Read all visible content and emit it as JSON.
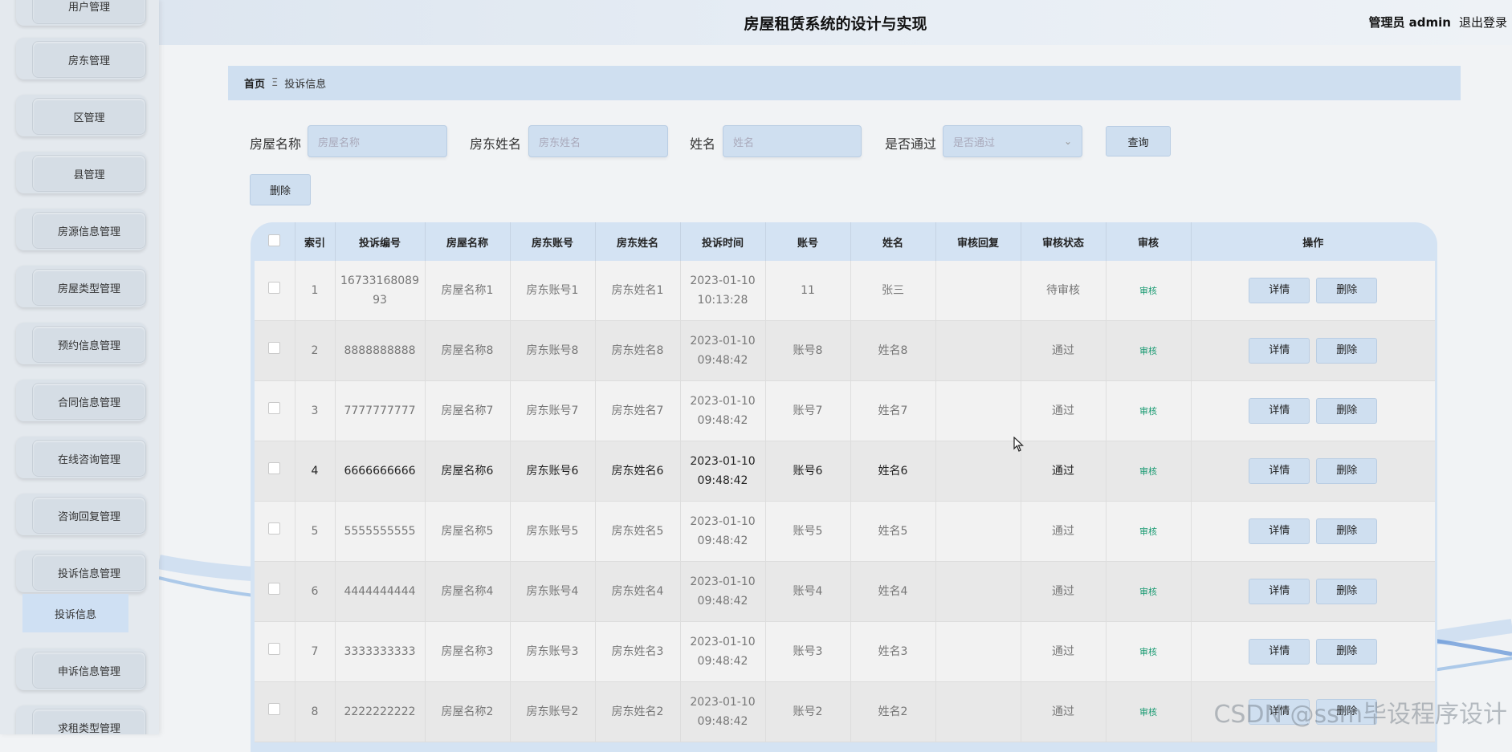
{
  "app_title": "房屋租赁系统的设计与实现",
  "user": {
    "label": "管理员 admin",
    "logout": "退出登录"
  },
  "sidebar": {
    "items": [
      {
        "label": "用户管理"
      },
      {
        "label": "房东管理"
      },
      {
        "label": "区管理"
      },
      {
        "label": "县管理"
      },
      {
        "label": "房源信息管理"
      },
      {
        "label": "房屋类型管理"
      },
      {
        "label": "预约信息管理"
      },
      {
        "label": "合同信息管理"
      },
      {
        "label": "在线咨询管理"
      },
      {
        "label": "咨询回复管理"
      },
      {
        "label": "投诉信息管理"
      },
      {
        "label": "申诉信息管理"
      },
      {
        "label": "求租类型管理"
      }
    ],
    "active_sub": "投诉信息"
  },
  "breadcrumb": {
    "home": "首页",
    "sep": "Ξ",
    "current": "投诉信息"
  },
  "search": {
    "house_name": {
      "label": "房屋名称",
      "placeholder": "房屋名称"
    },
    "landlord_name": {
      "label": "房东姓名",
      "placeholder": "房东姓名"
    },
    "name": {
      "label": "姓名",
      "placeholder": "姓名"
    },
    "passed": {
      "label": "是否通过",
      "placeholder": "是否通过"
    },
    "query_label": "查询"
  },
  "delete_label": "删除",
  "table": {
    "headers": [
      "索引",
      "投诉编号",
      "房屋名称",
      "房东账号",
      "房东姓名",
      "投诉时间",
      "账号",
      "姓名",
      "审核回复",
      "审核状态",
      "审核",
      "操作"
    ],
    "rows": [
      {
        "idx": "1",
        "code": "16733168089\n93",
        "house": "房屋名称1",
        "acct": "房东账号1",
        "lname": "房东姓名1",
        "time": "2023-01-10\n10:13:28",
        "user": "11",
        "name": "张三",
        "reply": "",
        "status": "待审核",
        "audit": "审核"
      },
      {
        "idx": "2",
        "code": "8888888888",
        "house": "房屋名称8",
        "acct": "房东账号8",
        "lname": "房东姓名8",
        "time": "2023-01-10\n09:48:42",
        "user": "账号8",
        "name": "姓名8",
        "reply": "",
        "status": "通过",
        "audit": "审核"
      },
      {
        "idx": "3",
        "code": "7777777777",
        "house": "房屋名称7",
        "acct": "房东账号7",
        "lname": "房东姓名7",
        "time": "2023-01-10\n09:48:42",
        "user": "账号7",
        "name": "姓名7",
        "reply": "",
        "status": "通过",
        "audit": "审核"
      },
      {
        "idx": "4",
        "code": "6666666666",
        "house": "房屋名称6",
        "acct": "房东账号6",
        "lname": "房东姓名6",
        "time": "2023-01-10\n09:48:42",
        "user": "账号6",
        "name": "姓名6",
        "reply": "",
        "status": "通过",
        "audit": "审核"
      },
      {
        "idx": "5",
        "code": "5555555555",
        "house": "房屋名称5",
        "acct": "房东账号5",
        "lname": "房东姓名5",
        "time": "2023-01-10\n09:48:42",
        "user": "账号5",
        "name": "姓名5",
        "reply": "",
        "status": "通过",
        "audit": "审核"
      },
      {
        "idx": "6",
        "code": "4444444444",
        "house": "房屋名称4",
        "acct": "房东账号4",
        "lname": "房东姓名4",
        "time": "2023-01-10\n09:48:42",
        "user": "账号4",
        "name": "姓名4",
        "reply": "",
        "status": "通过",
        "audit": "审核"
      },
      {
        "idx": "7",
        "code": "3333333333",
        "house": "房屋名称3",
        "acct": "房东账号3",
        "lname": "房东姓名3",
        "time": "2023-01-10\n09:48:42",
        "user": "账号3",
        "name": "姓名3",
        "reply": "",
        "status": "通过",
        "audit": "审核"
      },
      {
        "idx": "8",
        "code": "2222222222",
        "house": "房屋名称2",
        "acct": "房东账号2",
        "lname": "房东姓名2",
        "time": "2023-01-10\n09:48:42",
        "user": "账号2",
        "name": "姓名2",
        "reply": "",
        "status": "通过",
        "audit": "审核"
      }
    ],
    "detail_label": "详情",
    "row_delete_label": "删除"
  },
  "watermark": "CSDN @ssm毕设程序设计",
  "colors": {
    "accent": "#cfdff0",
    "audit_link": "#1a9a72"
  }
}
